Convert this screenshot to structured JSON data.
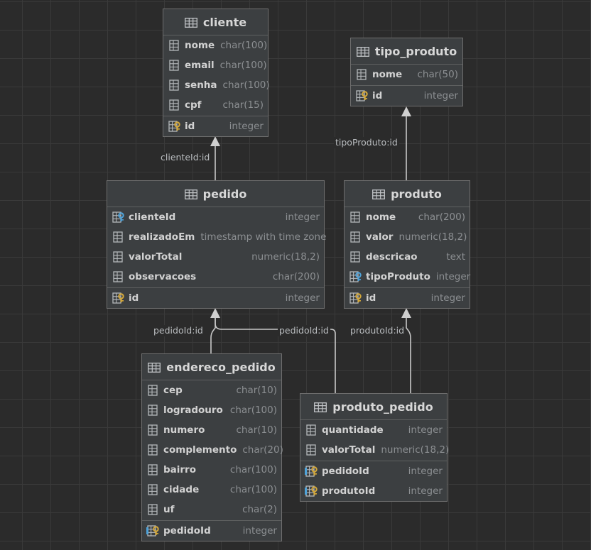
{
  "colors": {
    "background": "#2b2b2b",
    "grid": "#3a3a3a",
    "box": "#3c3f41",
    "border": "#6e6e6e",
    "connector": "#c8c8c8",
    "key_gold": "#d4a83a",
    "fk_blue": "#4fa3d9"
  },
  "tables": [
    {
      "id": "cliente",
      "title": "cliente",
      "columns": [
        {
          "name": "nome",
          "type": "char(100)",
          "icon": "column-icon"
        },
        {
          "name": "email",
          "type": "char(100)",
          "icon": "column-icon"
        },
        {
          "name": "senha",
          "type": "char(100)",
          "icon": "column-icon"
        },
        {
          "name": "cpf",
          "type": "char(15)",
          "icon": "column-icon"
        }
      ],
      "keys": [
        {
          "name": "id",
          "type": "integer",
          "icon": "primary-key-icon"
        }
      ]
    },
    {
      "id": "tipo_produto",
      "title": "tipo_produto",
      "columns": [
        {
          "name": "nome",
          "type": "char(50)",
          "icon": "column-icon"
        }
      ],
      "keys": [
        {
          "name": "id",
          "type": "integer",
          "icon": "primary-key-icon"
        }
      ]
    },
    {
      "id": "pedido",
      "title": "pedido",
      "columns": [
        {
          "name": "clienteId",
          "type": "integer",
          "icon": "foreign-key-icon"
        },
        {
          "name": "realizadoEm",
          "type": "timestamp with time zone",
          "icon": "column-icon"
        },
        {
          "name": "valorTotal",
          "type": "numeric(18,2)",
          "icon": "column-icon"
        },
        {
          "name": "observacoes",
          "type": "char(200)",
          "icon": "column-icon"
        }
      ],
      "keys": [
        {
          "name": "id",
          "type": "integer",
          "icon": "primary-key-icon"
        }
      ]
    },
    {
      "id": "produto",
      "title": "produto",
      "columns": [
        {
          "name": "nome",
          "type": "char(200)",
          "icon": "column-icon"
        },
        {
          "name": "valor",
          "type": "numeric(18,2)",
          "icon": "column-icon"
        },
        {
          "name": "descricao",
          "type": "text",
          "icon": "column-icon"
        },
        {
          "name": "tipoProduto",
          "type": "integer",
          "icon": "foreign-key-icon"
        }
      ],
      "keys": [
        {
          "name": "id",
          "type": "integer",
          "icon": "primary-key-icon"
        }
      ]
    },
    {
      "id": "endereco_pedido",
      "title": "endereco_pedido",
      "columns": [
        {
          "name": "cep",
          "type": "char(10)",
          "icon": "column-icon"
        },
        {
          "name": "logradouro",
          "type": "char(100)",
          "icon": "column-icon"
        },
        {
          "name": "numero",
          "type": "char(10)",
          "icon": "column-icon"
        },
        {
          "name": "complemento",
          "type": "char(20)",
          "icon": "column-icon"
        },
        {
          "name": "bairro",
          "type": "char(100)",
          "icon": "column-icon"
        },
        {
          "name": "cidade",
          "type": "char(100)",
          "icon": "column-icon"
        },
        {
          "name": "uf",
          "type": "char(2)",
          "icon": "column-icon"
        }
      ],
      "keys": [
        {
          "name": "pedidoId",
          "type": "integer",
          "icon": "primary-foreign-key-icon"
        }
      ]
    },
    {
      "id": "produto_pedido",
      "title": "produto_pedido",
      "columns": [
        {
          "name": "quantidade",
          "type": "integer",
          "icon": "column-icon"
        },
        {
          "name": "valorTotal",
          "type": "numeric(18,2)",
          "icon": "column-icon"
        }
      ],
      "keys": [
        {
          "name": "pedidoId",
          "type": "integer",
          "icon": "primary-foreign-key-icon"
        },
        {
          "name": "produtoId",
          "type": "integer",
          "icon": "primary-foreign-key-icon"
        }
      ]
    }
  ],
  "relations": [
    {
      "id": "rel-pedido-cliente",
      "label": "clienteId:id"
    },
    {
      "id": "rel-produto-tipo",
      "label": "tipoProduto:id"
    },
    {
      "id": "rel-endereco-pedido",
      "label": "pedidoId:id"
    },
    {
      "id": "rel-prodped-pedido",
      "label": "pedidoId:id"
    },
    {
      "id": "rel-prodped-produto",
      "label": "produtoId:id"
    }
  ]
}
